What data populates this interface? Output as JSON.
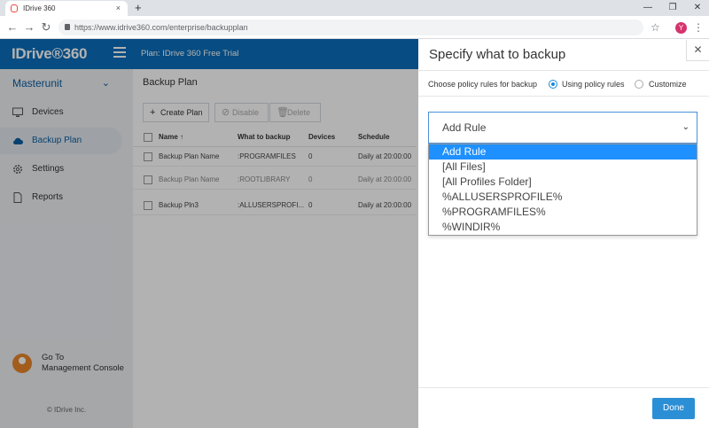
{
  "browser": {
    "tab_title": "IDrive 360",
    "tab_close": "×",
    "new_tab": "+",
    "url": "https://www.idrive360.com/enterprise/backupplan",
    "profile_initial": "Y",
    "controls": {
      "minimize": "—",
      "restore": "❐",
      "close": "✕"
    }
  },
  "app": {
    "logo": "IDrive®360",
    "plan_label": "Plan: IDrive 360 Free Trial",
    "org_selector": "Masterunit",
    "sidebar": {
      "items": [
        {
          "label": "Devices",
          "icon": "monitor-icon"
        },
        {
          "label": "Backup Plan",
          "icon": "cloud-upload-icon"
        },
        {
          "label": "Settings",
          "icon": "gear-icon"
        },
        {
          "label": "Reports",
          "icon": "document-icon"
        }
      ],
      "goto_line1": "Go To",
      "goto_line2": "Management Console",
      "copyright": "© IDrive Inc."
    },
    "main": {
      "title": "Backup Plan",
      "toolbar": {
        "create": "Create Plan",
        "disable": "Disable",
        "delete": "Delete"
      },
      "columns": [
        "Name",
        "What to backup",
        "Devices",
        "Schedule"
      ],
      "rows": [
        {
          "name": "Backup Plan Name",
          "what": ":PROGRAMFILES",
          "devices": "0",
          "schedule": "Daily at 20:00:00"
        },
        {
          "name": "Backup Plan Name",
          "what": ":ROOTLIBRARY",
          "devices": "0",
          "schedule": "Daily at 20:00:00"
        },
        {
          "name": "Backup Pln3",
          "what": ":ALLUSERSPROFI...",
          "devices": "0",
          "schedule": "Daily at 20:00:00"
        }
      ]
    }
  },
  "panel": {
    "title": "Specify what to backup",
    "close": "✕",
    "policy_label": "Choose policy rules for backup",
    "radio_using": "Using policy rules",
    "radio_customize": "Customize",
    "select_value": "Add Rule",
    "options": [
      "Add Rule",
      "[All Files]",
      "[All Profiles Folder]",
      "%ALLUSERSPROFILE%",
      "%PROGRAMFILES%",
      "%WINDIR%"
    ],
    "done": "Done"
  },
  "colors": {
    "brand_blue": "#0b6eba",
    "accent": "#2b8fd6",
    "selected_option": "#1e90ff"
  }
}
